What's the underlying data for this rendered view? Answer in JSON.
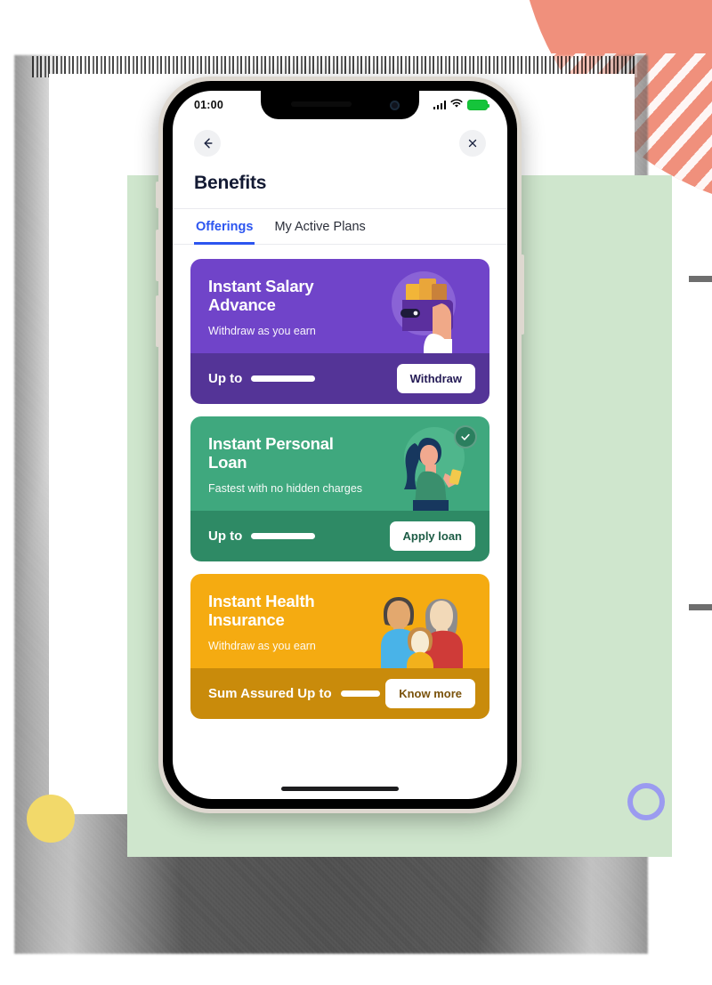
{
  "status_bar": {
    "time": "01:00",
    "signal_icon": "cellular-signal-icon",
    "wifi_icon": "wifi-icon",
    "battery_icon": "battery-full-icon",
    "battery_color": "#15c43b"
  },
  "app_bar": {
    "back_icon": "arrow-left-icon",
    "close_icon": "close-icon"
  },
  "header": {
    "title": "Benefits"
  },
  "tabs": [
    {
      "label": "Offerings",
      "active": true
    },
    {
      "label": "My Active Plans",
      "active": false
    }
  ],
  "accent_color": "#2c55f0",
  "cards": [
    {
      "id": "instant-salary-advance",
      "title": "Instant Salary Advance",
      "subtitle": "Withdraw as you earn",
      "footer_label": "Up to",
      "amount_masked": true,
      "cta_label": "Withdraw",
      "color_top": "#7044c9",
      "color_bottom": "#543497",
      "illustration": "hand-holding-wallet-with-cash-illustration",
      "badge": null
    },
    {
      "id": "instant-personal-loan",
      "title": "Instant Personal Loan",
      "subtitle": "Fastest with no hidden charges",
      "footer_label": "Up to",
      "amount_masked": true,
      "cta_label": "Apply loan",
      "color_top": "#3fa87e",
      "color_bottom": "#2e8a65",
      "illustration": "woman-holding-card-illustration",
      "badge": "check-circle-icon"
    },
    {
      "id": "instant-health-insurance",
      "title": "Instant Health Insurance",
      "subtitle": "Withdraw as you earn",
      "footer_label": "Sum Assured Up to",
      "amount_masked": true,
      "cta_label": "Know more",
      "color_top": "#f5ab11",
      "color_bottom": "#c98b0b",
      "illustration": "family-of-three-illustration",
      "badge": null
    }
  ],
  "decorations": {
    "coral_wedge_color": "#f0907c",
    "yellow_dot_color": "#f2d96a",
    "purple_ring_color": "#9b9bf0",
    "green_panel_color": "#cfe6cd",
    "edge_bar_color": "#6e6e6e"
  }
}
